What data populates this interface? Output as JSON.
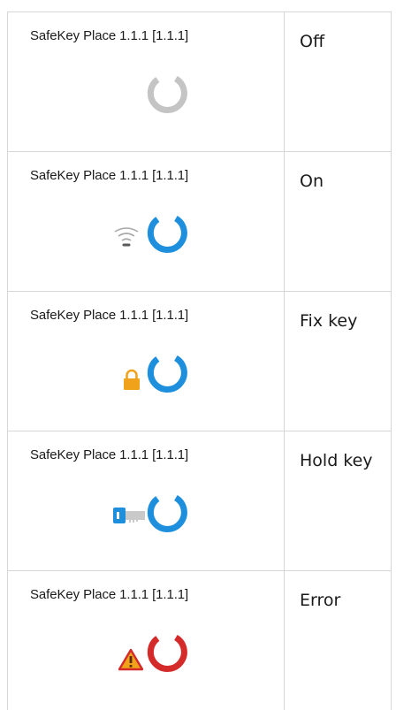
{
  "rows": [
    {
      "device": "SafeKey Place 1.1.1 [1.1.1]",
      "state": "Off",
      "icon": "ring-off-icon",
      "ring_color": "#c4c4c4",
      "badge": null
    },
    {
      "device": "SafeKey Place 1.1.1 [1.1.1]",
      "state": "On",
      "icon": "ring-on-icon",
      "ring_color": "#1e8fdc",
      "badge": "wifi-icon"
    },
    {
      "device": "SafeKey Place 1.1.1 [1.1.1]",
      "state": "Fix key",
      "icon": "ring-fixkey-icon",
      "ring_color": "#1e8fdc",
      "badge": "lock-icon"
    },
    {
      "device": "SafeKey Place 1.1.1 [1.1.1]",
      "state": "Hold key",
      "icon": "ring-holdkey-icon",
      "ring_color": "#1e8fdc",
      "badge": "key-icon"
    },
    {
      "device": "SafeKey Place 1.1.1 [1.1.1]",
      "state": "Error",
      "icon": "ring-error-icon",
      "ring_color": "#d42a2a",
      "badge": "warning-icon"
    }
  ],
  "colors": {
    "lock": "#f0a21a",
    "key": "#1e8fdc",
    "warning_fill": "#f0a21a",
    "warning_stroke": "#d42a2a",
    "grid": "#d6d6d6"
  }
}
